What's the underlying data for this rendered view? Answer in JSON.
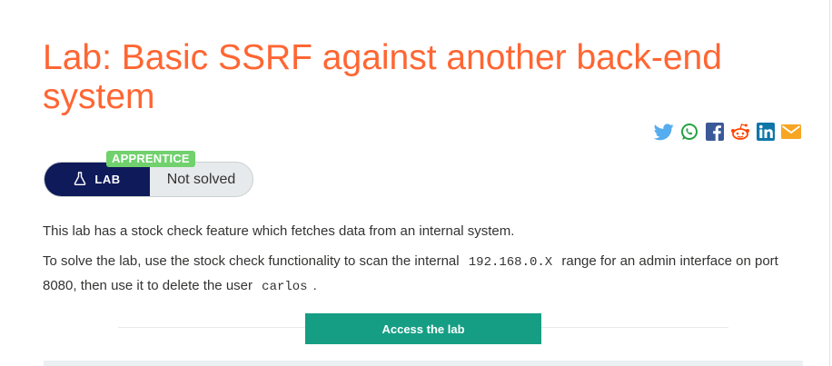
{
  "page": {
    "title": "Lab: Basic SSRF against another back-end system"
  },
  "share": {
    "icons": [
      "twitter-icon",
      "whatsapp-icon",
      "facebook-icon",
      "reddit-icon",
      "linkedin-icon",
      "email-icon"
    ]
  },
  "lab": {
    "level": "APPRENTICE",
    "tag": "LAB",
    "status": "Not solved"
  },
  "description": {
    "p1": "This lab has a stock check feature which fetches data from an internal system.",
    "p2_part1": "To solve the lab, use the stock check functionality to scan the internal",
    "p2_code1": "192.168.0.X",
    "p2_part2": "range for an admin interface on port 8080, then use it to delete the user",
    "p2_code2": "carlos",
    "p2_part3": "."
  },
  "actions": {
    "access_lab": "Access the lab"
  },
  "colors": {
    "title": "#ff6633",
    "level_badge": "#70d16d",
    "lab_tag": "#0f1a5a",
    "access_button": "#159e84"
  }
}
